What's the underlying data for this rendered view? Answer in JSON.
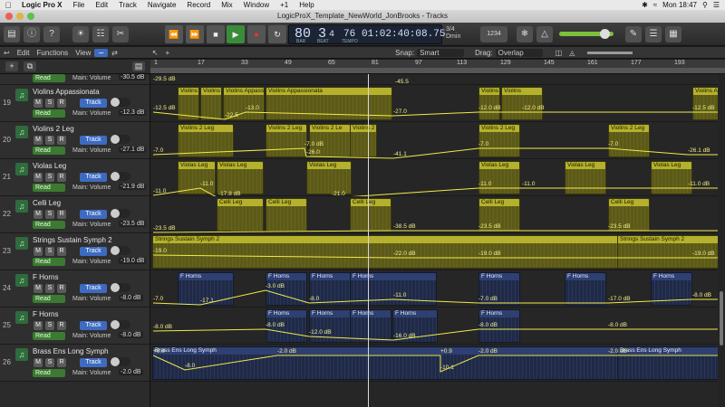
{
  "menubar": {
    "apple": "",
    "app": "Logic Pro X",
    "items": [
      "File",
      "Edit",
      "Track",
      "Navigate",
      "Record",
      "Mix",
      "Window",
      "+1",
      "Help"
    ],
    "clock": "Mon 18:47"
  },
  "window": {
    "title": "LogicProX_Template_NewWorld_JonBrooks - Tracks"
  },
  "toolbar": {
    "lcd": {
      "bar": "80",
      "beat": "3",
      "div": "4",
      "bar_label": "BAR",
      "beat_label": "BEAT",
      "tempo": "76",
      "tempo_label": "TEMPO",
      "time": "01:02:40:08.75",
      "sig_top": "3/4",
      "sig_bot": "Dmin"
    },
    "midi_value": "1234"
  },
  "secondary": {
    "edit": "Edit",
    "functions": "Functions",
    "view": "View",
    "snap_label": "Snap:",
    "snap_value": "Smart",
    "drag_label": "Drag:",
    "drag_value": "Overlap"
  },
  "ruler": {
    "marks": [
      "1",
      "17",
      "33",
      "49",
      "65",
      "81",
      "97",
      "113",
      "129",
      "145",
      "161",
      "177",
      "193"
    ]
  },
  "tracks": [
    {
      "num": "19",
      "name": "Violins Appassionata",
      "mode": "Read",
      "param": "Main: Volume",
      "value": "-12.3 dB"
    },
    {
      "num": "20",
      "name": "Violins 2 Leg",
      "mode": "Read",
      "param": "Main: Volume",
      "value": "-27.1 dB"
    },
    {
      "num": "21",
      "name": "Violas Leg",
      "mode": "Read",
      "param": "Main: Volume",
      "value": "-21.9 dB"
    },
    {
      "num": "22",
      "name": "Celli Leg",
      "mode": "Read",
      "param": "Main: Volume",
      "value": "-23.5 dB"
    },
    {
      "num": "23",
      "name": "Strings Sustain Symph 2",
      "mode": "Read",
      "param": "Main: Volume",
      "value": "-19.0 dB"
    },
    {
      "num": "24",
      "name": "F Horns",
      "mode": "Read",
      "param": "Main: Volume",
      "value": "-8.0 dB"
    },
    {
      "num": "25",
      "name": "F Horns",
      "mode": "Read",
      "param": "Main: Volume",
      "value": "-8.0 dB"
    },
    {
      "num": "26",
      "name": "Brass Ens Long Symph",
      "mode": "Read",
      "param": "Main: Volume",
      "value": "-2.0 dB"
    }
  ],
  "top_partial": {
    "mode": "Read",
    "param": "Main: Volume",
    "value": "-30.5 dB",
    "auto_left": "-29.5 dB",
    "auto_mid": "-45.5"
  },
  "lanes": [
    {
      "regions": [
        {
          "name": "Violins",
          "kind": "str"
        },
        {
          "name": "Violins",
          "kind": "str"
        },
        {
          "name": "Violins Appassio",
          "kind": "str"
        },
        {
          "name": "Violins Appassionata",
          "kind": "str"
        },
        {
          "name": "Violins",
          "kind": "str"
        },
        {
          "name": "Violins",
          "kind": "str"
        },
        {
          "name": "Violins Appassionata",
          "kind": "str"
        }
      ],
      "auto": [
        "-12.5 dB",
        "-22.5",
        "-13.0",
        "-27.0",
        "-12.0 dB",
        "-12.0 dB",
        "-12.5 dB"
      ]
    },
    {
      "regions": [
        {
          "name": "Violins 2 Leg",
          "kind": "str"
        },
        {
          "name": "Violins 2 Leg",
          "kind": "str"
        },
        {
          "name": "Violins 2 Le",
          "kind": "str"
        },
        {
          "name": "Violins 2 Leg",
          "kind": "str"
        },
        {
          "name": "Violins 2 Leg",
          "kind": "str"
        },
        {
          "name": "Violins 2 Leg",
          "kind": "str"
        }
      ],
      "auto": [
        "-7.0",
        "-7.0 dB",
        "-26.0",
        "-41.1",
        "-7.0",
        "-7.0",
        "-26.1 dB"
      ]
    },
    {
      "regions": [
        {
          "name": "Violas Leg",
          "kind": "str"
        },
        {
          "name": "Violas Leg",
          "kind": "str"
        },
        {
          "name": "Violas Leg",
          "kind": "str"
        },
        {
          "name": "Violas Leg",
          "kind": "str"
        },
        {
          "name": "Violas Leg",
          "kind": "str"
        },
        {
          "name": "Violas Leg",
          "kind": "str"
        }
      ],
      "auto": [
        "-11.0",
        "-11.0",
        "-17.8 dB",
        "-21.0",
        "-11.0",
        "-11.0",
        "-11.0 dB"
      ]
    },
    {
      "regions": [
        {
          "name": "Celli Leg",
          "kind": "str"
        },
        {
          "name": "Celli Leg",
          "kind": "str"
        },
        {
          "name": "Celli Leg",
          "kind": "str"
        },
        {
          "name": "Celli Leg",
          "kind": "str"
        },
        {
          "name": "Celli Leg",
          "kind": "str"
        }
      ],
      "auto": [
        "-23.5 dB",
        "-38.5 dB",
        "-23.5 dB",
        "-23.5 dB"
      ]
    },
    {
      "regions": [
        {
          "name": "Strings Sustain Symph 2",
          "kind": "str"
        },
        {
          "name": "Strings Sustain Symph 2",
          "kind": "str"
        }
      ],
      "auto": [
        "-19.0",
        "-22.0 dB",
        "-19.0 dB",
        "-19.0 dB"
      ]
    },
    {
      "regions": [
        {
          "name": "F Horns",
          "kind": "brs"
        },
        {
          "name": "F Horns",
          "kind": "brs"
        },
        {
          "name": "F Horns",
          "kind": "brs"
        },
        {
          "name": "F Horns",
          "kind": "brs"
        },
        {
          "name": "F Horns",
          "kind": "brs"
        },
        {
          "name": "F Horns",
          "kind": "brs"
        },
        {
          "name": "F Horns",
          "kind": "brs"
        }
      ],
      "auto": [
        "-7.0",
        "-17.1",
        "-3.0 dB",
        "-8.0",
        "-11.0",
        "-7.0 dB",
        "-17.0 dB",
        "-8.0 dB"
      ]
    },
    {
      "regions": [
        {
          "name": "F Horns",
          "kind": "brs"
        },
        {
          "name": "F Horns",
          "kind": "brs"
        },
        {
          "name": "F Horns",
          "kind": "brs"
        },
        {
          "name": "F Horns",
          "kind": "brs"
        },
        {
          "name": "F Horns",
          "kind": "brs"
        }
      ],
      "auto": [
        "-8.0 dB",
        "-8.0 dB",
        "-12.0 dB",
        "-16.0 dB",
        "-8.0 dB",
        "-8.0 dB"
      ]
    },
    {
      "regions": [
        {
          "name": "Brass Ens Long Symph",
          "kind": "brs"
        },
        {
          "name": "Brass Ens Long Symph",
          "kind": "brs"
        }
      ],
      "auto": [
        "+0.0",
        "-8.0",
        "-2.0 dB",
        "+0.9",
        "-10.1",
        "-2.0 dB",
        "-2.0 dB"
      ]
    }
  ],
  "colors": {
    "region_strings": "#b5b12c",
    "region_brass": "#2e3f72",
    "track_button": "#3d6bc1",
    "read_button": "#3c7a32"
  }
}
